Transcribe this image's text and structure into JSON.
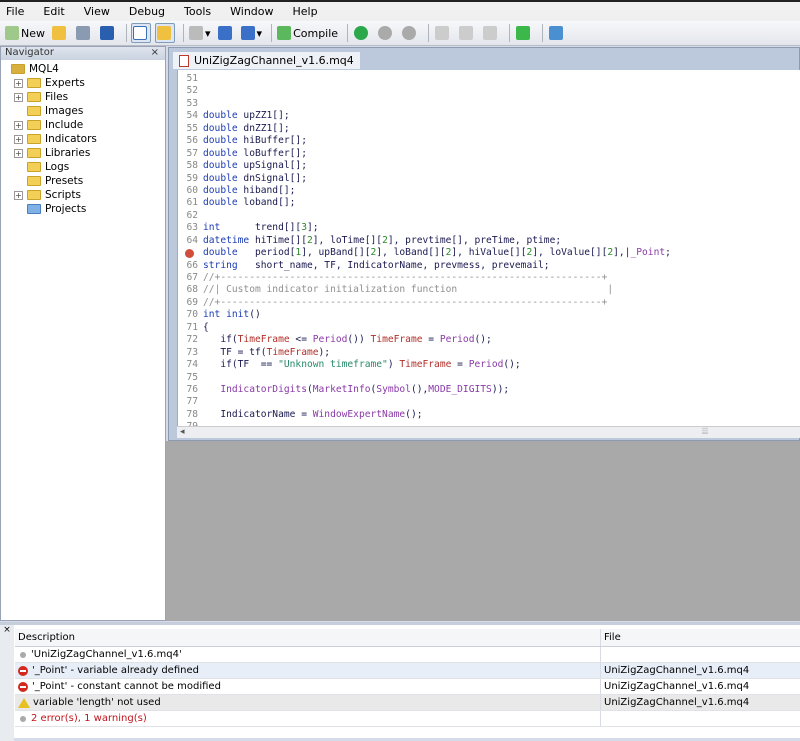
{
  "menu": [
    "File",
    "Edit",
    "View",
    "Debug",
    "Tools",
    "Window",
    "Help"
  ],
  "toolbar": {
    "new_label": "New",
    "compile_label": "Compile"
  },
  "navigator": {
    "title": "Navigator",
    "root": "MQL4",
    "items": [
      {
        "label": "Experts",
        "expandable": true
      },
      {
        "label": "Files",
        "expandable": true
      },
      {
        "label": "Images",
        "expandable": false
      },
      {
        "label": "Include",
        "expandable": true
      },
      {
        "label": "Indicators",
        "expandable": true
      },
      {
        "label": "Libraries",
        "expandable": true
      },
      {
        "label": "Logs",
        "expandable": false
      },
      {
        "label": "Presets",
        "expandable": false
      },
      {
        "label": "Scripts",
        "expandable": true
      },
      {
        "label": "Projects",
        "expandable": false
      }
    ]
  },
  "editor": {
    "tab": "UniZigZagChannel_v1.6.mq4",
    "error_line": 65,
    "lines": [
      {
        "n": "51",
        "s": []
      },
      {
        "n": "52",
        "s": []
      },
      {
        "n": "53",
        "s": []
      },
      {
        "n": "54",
        "s": [
          [
            "kw",
            "double"
          ],
          [
            "txt",
            " upZZ1[];"
          ]
        ]
      },
      {
        "n": "55",
        "s": [
          [
            "kw",
            "double"
          ],
          [
            "txt",
            " dnZZ1[];"
          ]
        ]
      },
      {
        "n": "56",
        "s": [
          [
            "kw",
            "double"
          ],
          [
            "txt",
            " hiBuffer[];"
          ]
        ]
      },
      {
        "n": "57",
        "s": [
          [
            "kw",
            "double"
          ],
          [
            "txt",
            " loBuffer[];"
          ]
        ]
      },
      {
        "n": "58",
        "s": [
          [
            "kw",
            "double"
          ],
          [
            "txt",
            " upSignal[];"
          ]
        ]
      },
      {
        "n": "59",
        "s": [
          [
            "kw",
            "double"
          ],
          [
            "txt",
            " dnSignal[];"
          ]
        ]
      },
      {
        "n": "60",
        "s": [
          [
            "kw",
            "double"
          ],
          [
            "txt",
            " hiband[];"
          ]
        ]
      },
      {
        "n": "61",
        "s": [
          [
            "kw",
            "double"
          ],
          [
            "txt",
            " loband[];"
          ]
        ]
      },
      {
        "n": "62",
        "s": []
      },
      {
        "n": "63",
        "s": [
          [
            "kw",
            "int"
          ],
          [
            "txt",
            "      trend[]["
          ],
          [
            "nm",
            "3"
          ],
          [
            "txt",
            "];"
          ]
        ]
      },
      {
        "n": "64",
        "s": [
          [
            "kw",
            "datetime"
          ],
          [
            "txt",
            " hiTime[]["
          ],
          [
            "nm",
            "2"
          ],
          [
            "txt",
            "], loTime[]["
          ],
          [
            "nm",
            "2"
          ],
          [
            "txt",
            "], prevtime[], preTime, ptime;"
          ]
        ]
      },
      {
        "n": "65",
        "s": [
          [
            "kw",
            "double"
          ],
          [
            "txt",
            "   period["
          ],
          [
            "nm",
            "1"
          ],
          [
            "txt",
            "], upBand[]["
          ],
          [
            "nm",
            "2"
          ],
          [
            "txt",
            "], loBand[]["
          ],
          [
            "nm",
            "2"
          ],
          [
            "txt",
            "], hiValue[]["
          ],
          [
            "nm",
            "2"
          ],
          [
            "txt",
            "], loValue[]["
          ],
          [
            "nm",
            "2"
          ],
          [
            "txt",
            "],|"
          ],
          [
            "fn",
            "_Point"
          ],
          [
            "txt",
            ";"
          ]
        ]
      },
      {
        "n": "66",
        "s": [
          [
            "kw",
            "string"
          ],
          [
            "txt",
            "   short_name, TF, IndicatorName, prevmess, prevemail;"
          ]
        ]
      },
      {
        "n": "67",
        "s": [
          [
            "cm",
            "//+------------------------------------------------------------------+"
          ]
        ]
      },
      {
        "n": "68",
        "s": [
          [
            "cm",
            "//| Custom indicator initialization function                          |"
          ]
        ]
      },
      {
        "n": "69",
        "s": [
          [
            "cm",
            "//+------------------------------------------------------------------+"
          ]
        ]
      },
      {
        "n": "70",
        "s": [
          [
            "kw",
            "int"
          ],
          [
            "txt",
            " "
          ],
          [
            "kw",
            "init"
          ],
          [
            "txt",
            "()"
          ]
        ]
      },
      {
        "n": "71",
        "s": [
          [
            "txt",
            "{"
          ]
        ]
      },
      {
        "n": "72",
        "s": [
          [
            "txt",
            "   if("
          ],
          [
            "vr",
            "TimeFrame"
          ],
          [
            "txt",
            " <= "
          ],
          [
            "fn",
            "Period"
          ],
          [
            "txt",
            "()) "
          ],
          [
            "vr",
            "TimeFrame"
          ],
          [
            "txt",
            " = "
          ],
          [
            "fn",
            "Period"
          ],
          [
            "txt",
            "();"
          ]
        ]
      },
      {
        "n": "73",
        "s": [
          [
            "txt",
            "   TF = tf("
          ],
          [
            "vr",
            "TimeFrame"
          ],
          [
            "txt",
            ");"
          ]
        ]
      },
      {
        "n": "74",
        "s": [
          [
            "txt",
            "   if(TF  == "
          ],
          [
            "st",
            "\"Unknown timeframe\""
          ],
          [
            "txt",
            ") "
          ],
          [
            "vr",
            "TimeFrame"
          ],
          [
            "txt",
            " = "
          ],
          [
            "fn",
            "Period"
          ],
          [
            "txt",
            "();"
          ]
        ]
      },
      {
        "n": "75",
        "s": []
      },
      {
        "n": "76",
        "s": [
          [
            "txt",
            "   "
          ],
          [
            "fn",
            "IndicatorDigits"
          ],
          [
            "txt",
            "("
          ],
          [
            "fn",
            "MarketInfo"
          ],
          [
            "txt",
            "("
          ],
          [
            "fn",
            "Symbol"
          ],
          [
            "txt",
            "(),"
          ],
          [
            "fn",
            "MODE_DIGITS"
          ],
          [
            "txt",
            "));"
          ]
        ]
      },
      {
        "n": "77",
        "s": []
      },
      {
        "n": "78",
        "s": [
          [
            "txt",
            "   IndicatorName = "
          ],
          [
            "fn",
            "WindowExpertName"
          ],
          [
            "txt",
            "();"
          ]
        ]
      },
      {
        "n": "79",
        "s": []
      }
    ]
  },
  "errors": {
    "col_description": "Description",
    "col_file": "File",
    "rows": [
      {
        "type": "info",
        "desc": "'UniZigZagChannel_v1.6.mq4'",
        "file": ""
      },
      {
        "type": "error",
        "desc": "'_Point' - variable already defined",
        "file": "UniZigZagChannel_v1.6.mq4"
      },
      {
        "type": "error",
        "desc": "'_Point' - constant cannot be modified",
        "file": "UniZigZagChannel_v1.6.mq4"
      },
      {
        "type": "warning",
        "desc": "variable 'length' not used",
        "file": "UniZigZagChannel_v1.6.mq4"
      },
      {
        "type": "summary",
        "desc": "2 error(s), 1 warning(s)",
        "file": ""
      }
    ]
  }
}
